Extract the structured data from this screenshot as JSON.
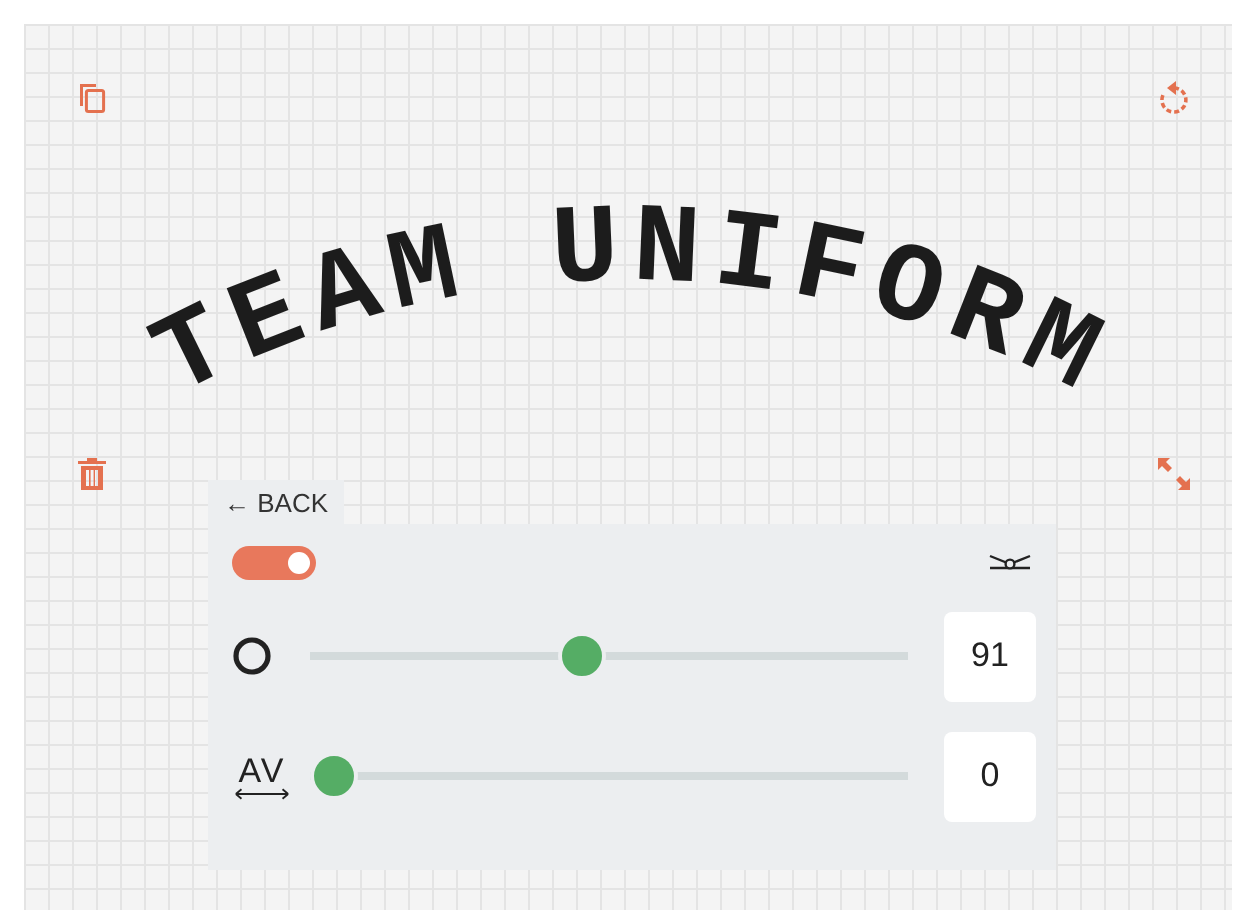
{
  "canvas": {
    "curved_text": "TEAM UNIFORM"
  },
  "panel": {
    "back_button": "← BACK",
    "toggle": {
      "on": true
    },
    "sliders": [
      {
        "kind": "outline",
        "level": 0.45,
        "value": "91"
      },
      {
        "kind": "spacing",
        "icon_text": "AV",
        "level": 0,
        "value": "0"
      }
    ]
  }
}
